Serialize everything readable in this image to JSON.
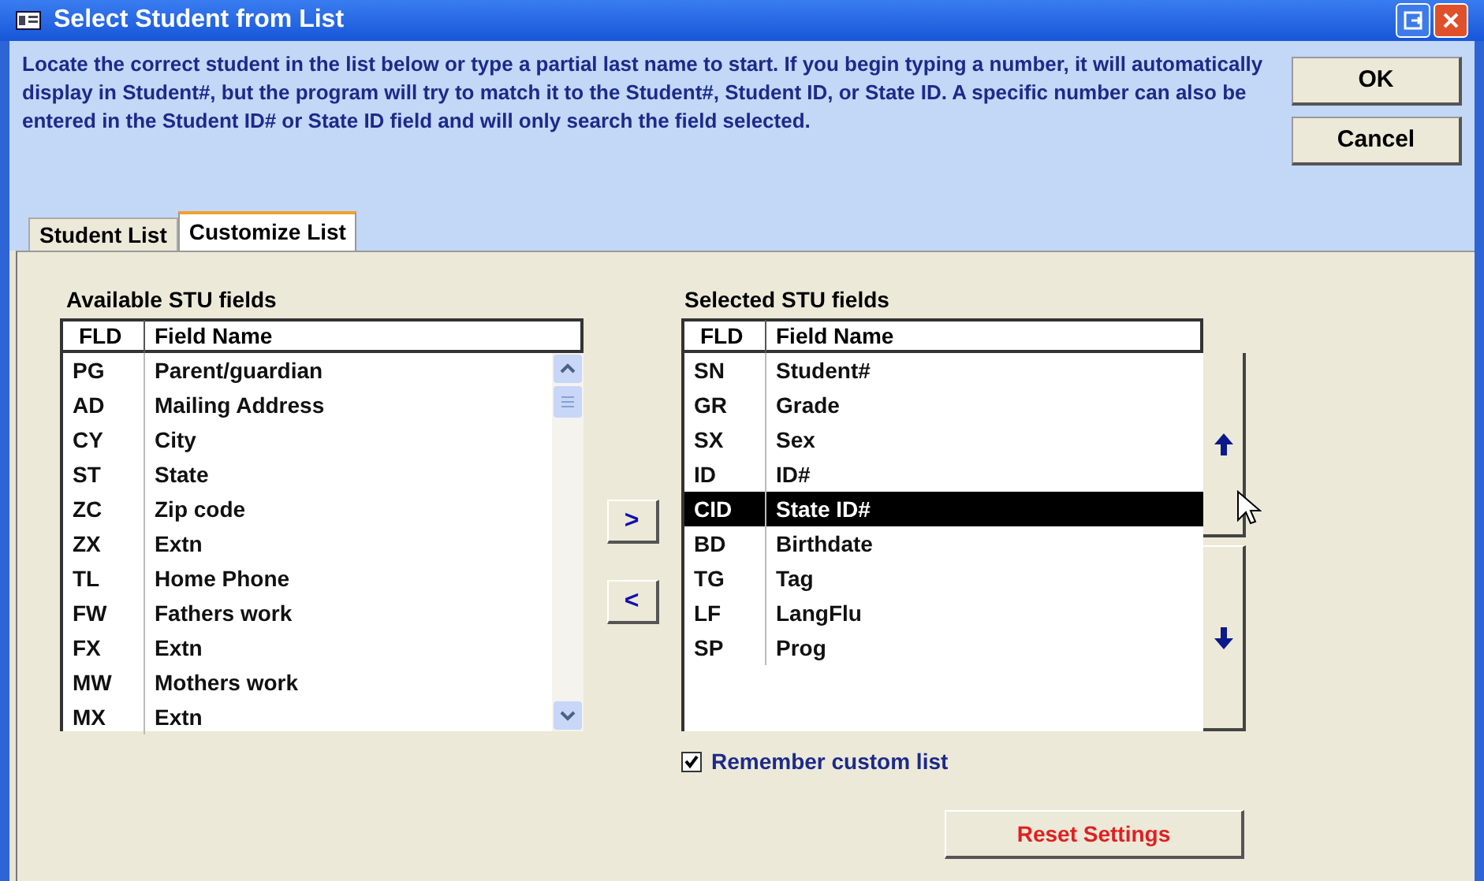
{
  "window": {
    "title": "Select Student from List"
  },
  "instructions": "Locate the correct student in the list below or type a partial last name to start.  If you begin typing a number, it will automatically display in Student#, but the program will try to match it to the Student#, Student ID, or State ID.  A specific number can also be entered in the Student ID# or State ID field and will only search the field selected.",
  "buttons": [
    "OK",
    "Cancel"
  ],
  "tabs": [
    {
      "label": "Student List",
      "selected": false
    },
    {
      "label": "Customize List",
      "selected": true
    }
  ],
  "available": {
    "title": "Available STU fields",
    "columns": [
      "FLD",
      "Field Name"
    ],
    "rows": [
      {
        "fld": "PG",
        "name": "Parent/guardian",
        "selected": false
      },
      {
        "fld": "AD",
        "name": "Mailing Address",
        "selected": false
      },
      {
        "fld": "CY",
        "name": "City",
        "selected": false
      },
      {
        "fld": "ST",
        "name": "State",
        "selected": false
      },
      {
        "fld": "ZC",
        "name": "Zip code",
        "selected": false
      },
      {
        "fld": "ZX",
        "name": "Extn",
        "selected": false
      },
      {
        "fld": "TL",
        "name": "Home Phone",
        "selected": false
      },
      {
        "fld": "FW",
        "name": "Fathers work",
        "selected": false
      },
      {
        "fld": "FX",
        "name": "Extn",
        "selected": false
      },
      {
        "fld": "MW",
        "name": "Mothers work",
        "selected": false
      },
      {
        "fld": "MX",
        "name": "Extn",
        "selected": false
      }
    ]
  },
  "move_buttons": [
    ">",
    "<"
  ],
  "selected_fields": {
    "title": "Selected STU fields",
    "columns": [
      "FLD",
      "Field Name"
    ],
    "rows": [
      {
        "fld": "SN",
        "name": "Student#",
        "selected": false
      },
      {
        "fld": "GR",
        "name": "Grade",
        "selected": false
      },
      {
        "fld": "SX",
        "name": "Sex",
        "selected": false
      },
      {
        "fld": "ID",
        "name": "ID#",
        "selected": false
      },
      {
        "fld": "CID",
        "name": "State ID#",
        "selected": true
      },
      {
        "fld": "BD",
        "name": "Birthdate",
        "selected": false
      },
      {
        "fld": "TG",
        "name": "Tag",
        "selected": false
      },
      {
        "fld": "LF",
        "name": "LangFlu",
        "selected": false
      },
      {
        "fld": "SP",
        "name": "Prog",
        "selected": false
      }
    ]
  },
  "remember": {
    "label": "Remember custom list",
    "checked": true
  },
  "reset_button": "Reset Settings"
}
